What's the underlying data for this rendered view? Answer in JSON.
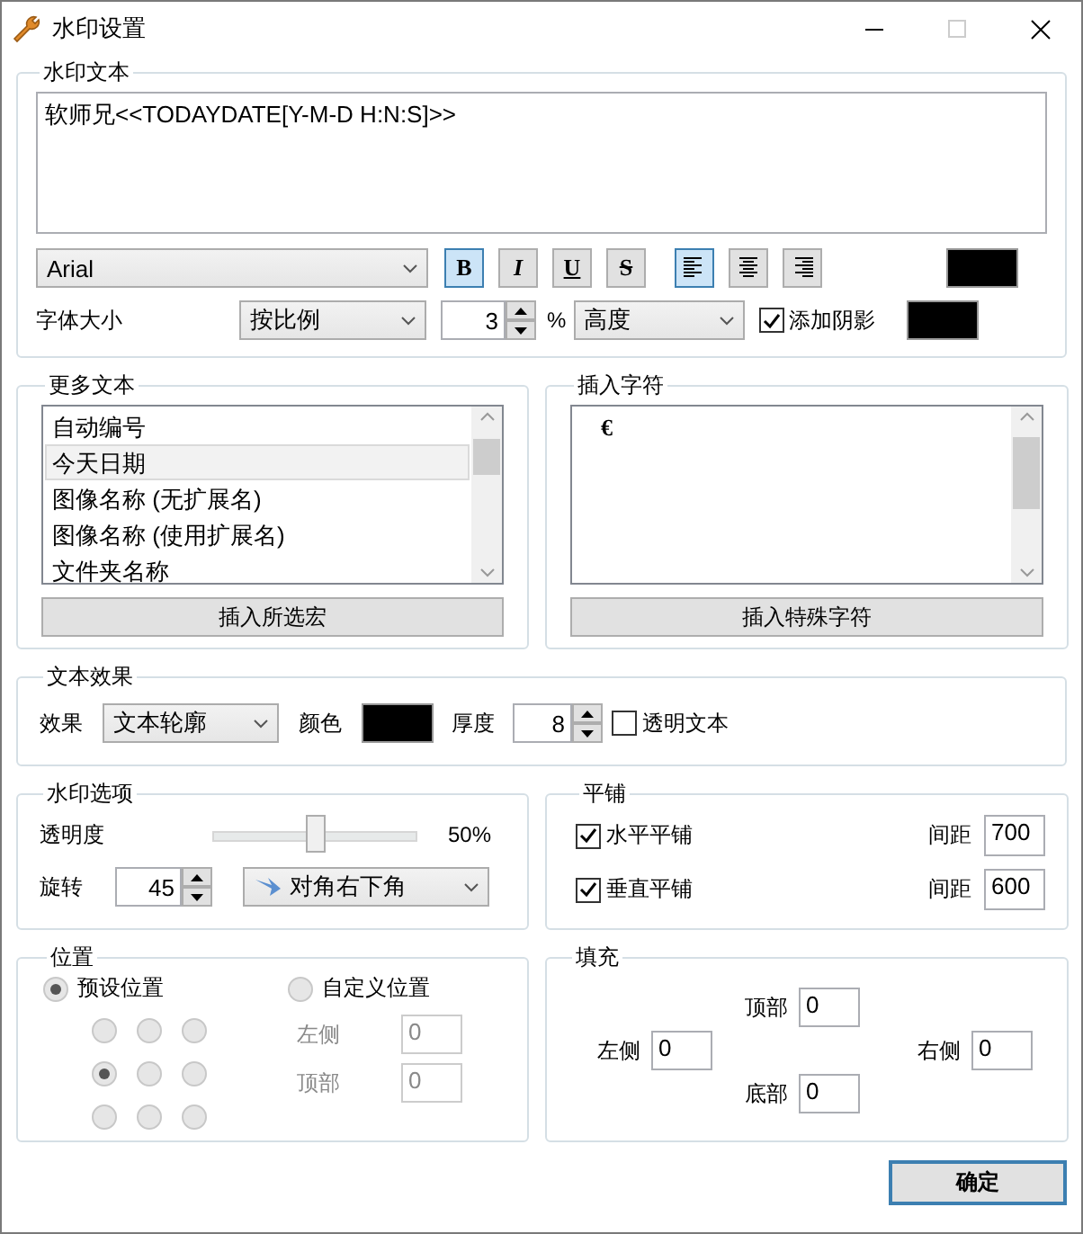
{
  "window": {
    "title": "水印设置",
    "maximize_disabled": true
  },
  "watermark_text": {
    "title": "水印文本",
    "value": "软师兄<<TODAYDATE[Y-M-D H:N:S]>>",
    "font": "Arial",
    "styles": [
      {
        "label": "B",
        "kind": "bold",
        "selected": true
      },
      {
        "label": "I",
        "kind": "italic",
        "selected": false
      },
      {
        "label": "U",
        "kind": "underline",
        "selected": false
      },
      {
        "label": "S",
        "kind": "strike",
        "selected": false
      }
    ],
    "alignment": [
      {
        "kind": "left",
        "selected": true
      },
      {
        "kind": "center",
        "selected": false
      },
      {
        "kind": "right",
        "selected": false
      }
    ],
    "text_color": {
      "color": "#000000"
    },
    "size_label": "字体大小",
    "size_mode": "按比例",
    "size_value": "3",
    "size_unit": "%",
    "size_basis": "高度",
    "shadow": {
      "label": "添加阴影",
      "checked": true,
      "color": "#000000"
    }
  },
  "more_text": {
    "title": "更多文本",
    "items": [
      {
        "label": "自动编号",
        "selected": false
      },
      {
        "label": "今天日期",
        "selected": true
      },
      {
        "label": "图像名称 (无扩展名)",
        "selected": false
      },
      {
        "label": "图像名称 (使用扩展名)",
        "selected": false
      },
      {
        "label": "文件夹名称",
        "selected": false
      }
    ],
    "button": "插入所选宏"
  },
  "insert_char": {
    "title": "插入字符",
    "items": [
      {
        "label": "€",
        "selected": false
      }
    ],
    "button": "插入特殊字符"
  },
  "text_effect": {
    "title": "文本效果",
    "effect_label": "效果",
    "effect": "文本轮廓",
    "color_label": "颜色",
    "color": "#000000",
    "thickness_label": "厚度",
    "thickness": "8",
    "transparent": {
      "label": "透明文本",
      "checked": false
    }
  },
  "options": {
    "title": "水印选项",
    "opacity_label": "透明度",
    "opacity": {
      "level": 0.5
    },
    "opacity_reading": "50%",
    "rotate_label": "旋转",
    "rotate": "45",
    "direction": "对角右下角"
  },
  "tiling": {
    "title": "平铺",
    "rows": [
      {
        "label": "水平平铺",
        "checked": true,
        "spacing_label": "间距",
        "spacing": "700"
      },
      {
        "label": "垂直平铺",
        "checked": true,
        "spacing_label": "间距",
        "spacing": "600"
      }
    ]
  },
  "position": {
    "title": "位置",
    "modes": [
      {
        "label": "预设位置",
        "selected": true
      },
      {
        "label": "自定义位置",
        "selected": false
      }
    ],
    "presets": [
      {
        "selected": false
      },
      {
        "selected": false
      },
      {
        "selected": false
      },
      {
        "selected": true
      },
      {
        "selected": false
      },
      {
        "selected": false
      },
      {
        "selected": false
      },
      {
        "selected": false
      },
      {
        "selected": false
      }
    ],
    "custom": [
      {
        "label": "左侧",
        "value": "0",
        "disabled": true
      },
      {
        "label": "顶部",
        "value": "0",
        "disabled": true
      }
    ]
  },
  "padding": {
    "title": "填充",
    "top": {
      "label": "顶部",
      "value": "0"
    },
    "left": {
      "label": "左侧",
      "value": "0"
    },
    "right": {
      "label": "右侧",
      "value": "0"
    },
    "bottom": {
      "label": "底部",
      "value": "0"
    }
  },
  "ok_button": "确定"
}
